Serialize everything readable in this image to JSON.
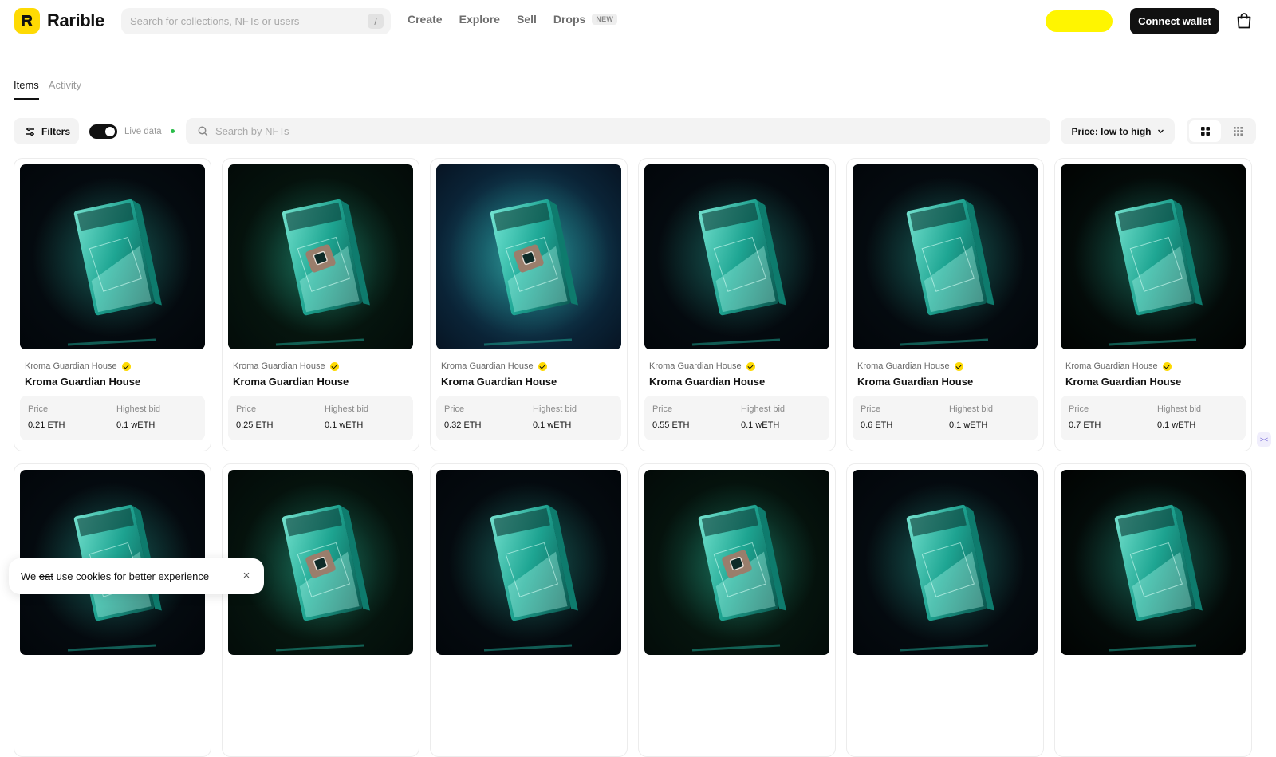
{
  "brand": {
    "name": "Rarible",
    "accent": "#FEDA03"
  },
  "search": {
    "placeholder": "Search for collections, NFTs or users",
    "shortcut": "/"
  },
  "nav": {
    "create": "Create",
    "explore": "Explore",
    "sell": "Sell",
    "drops": "Drops",
    "drops_badge": "NEW"
  },
  "header": {
    "connect_label": "Connect wallet",
    "highlight_color": "#FFF500"
  },
  "tabs": [
    {
      "label": "Items",
      "active": true
    },
    {
      "label": "Activity",
      "active": false
    }
  ],
  "toolbar": {
    "filters_label": "Filters",
    "live_label": "Live data",
    "live_on": true,
    "search_placeholder": "Search by NFTs",
    "sort_label": "Price: low to high",
    "view_mode": "grid-large"
  },
  "items": [
    {
      "collection": "Kroma Guardian House",
      "name": "Kroma Guardian House",
      "price_label": "Price",
      "price": "0.21 ETH",
      "bid_label": "Highest bid",
      "bid": "0.1 wETH",
      "art": "dark"
    },
    {
      "collection": "Kroma Guardian House",
      "name": "Kroma Guardian House",
      "price_label": "Price",
      "price": "0.25 ETH",
      "bid_label": "Highest bid",
      "bid": "0.1 wETH",
      "art": "green"
    },
    {
      "collection": "Kroma Guardian House",
      "name": "Kroma Guardian House",
      "price_label": "Price",
      "price": "0.32 ETH",
      "bid_label": "Highest bid",
      "bid": "0.1 wETH",
      "art": "space"
    },
    {
      "collection": "Kroma Guardian House",
      "name": "Kroma Guardian House",
      "price_label": "Price",
      "price": "0.55 ETH",
      "bid_label": "Highest bid",
      "bid": "0.1 wETH",
      "art": "dark"
    },
    {
      "collection": "Kroma Guardian House",
      "name": "Kroma Guardian House",
      "price_label": "Price",
      "price": "0.6 ETH",
      "bid_label": "Highest bid",
      "bid": "0.1 wETH",
      "art": "dark"
    },
    {
      "collection": "Kroma Guardian House",
      "name": "Kroma Guardian House",
      "price_label": "Price",
      "price": "0.7 ETH",
      "bid_label": "Highest bid",
      "bid": "0.1 wETH",
      "art": "blackish"
    },
    {
      "art": "dark"
    },
    {
      "art": "green"
    },
    {
      "art": "dark"
    },
    {
      "art": "green"
    },
    {
      "art": "dark"
    },
    {
      "art": "blackish"
    }
  ],
  "cookie": {
    "text_before": "We ",
    "struck": "eat",
    "text_after": " use cookies for better experience",
    "close": "×"
  }
}
